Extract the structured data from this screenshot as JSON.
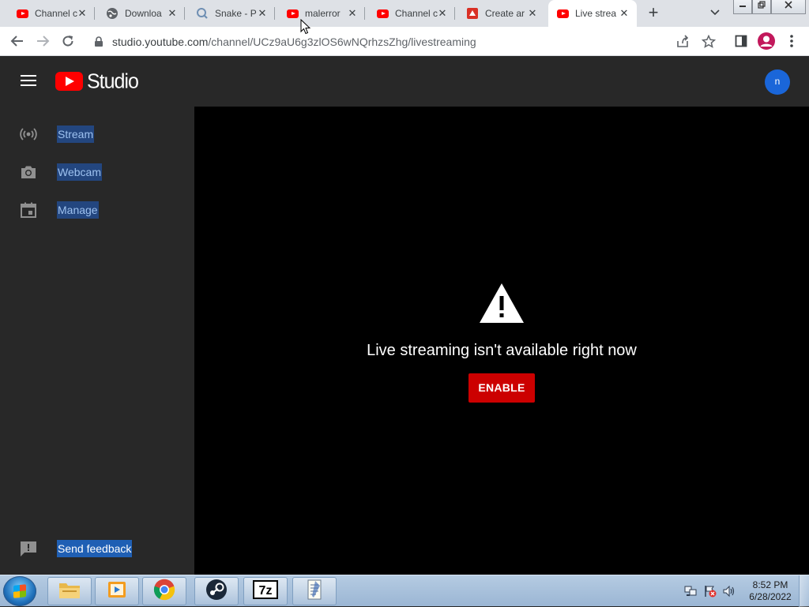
{
  "browser": {
    "tabs": [
      {
        "title": "Channel c",
        "favicon": "youtube-icon",
        "active": false
      },
      {
        "title": "Downloa",
        "favicon": "globe-icon",
        "active": false
      },
      {
        "title": "Snake - P",
        "favicon": "search-icon",
        "active": false
      },
      {
        "title": "malerror",
        "favicon": "youtube-icon",
        "active": false
      },
      {
        "title": "Channel c",
        "favicon": "youtube-icon",
        "active": false
      },
      {
        "title": "Create ar",
        "favicon": "app-icon",
        "active": false
      },
      {
        "title": "Live strea",
        "favicon": "youtube-icon",
        "active": true
      }
    ],
    "new_tab_label": "+",
    "url_host": "studio.youtube.com",
    "url_path": "/channel/UCz9aU6g3zlOS6wNQrhzsZhg/livestreaming"
  },
  "header": {
    "logo_text": "Studio",
    "avatar_letter": "n"
  },
  "sidebar": {
    "items": [
      {
        "label": "Stream",
        "icon": "broadcast-icon"
      },
      {
        "label": "Webcam",
        "icon": "camera-icon"
      },
      {
        "label": "Manage",
        "icon": "calendar-icon"
      }
    ],
    "feedback_label": "Send feedback"
  },
  "main": {
    "message": "Live streaming isn't available right now",
    "enable_label": "ENABLE"
  },
  "taskbar": {
    "time": "8:52 PM",
    "date": "6/28/2022"
  },
  "colors": {
    "brand_red": "#ff0000",
    "enable_button": "#cc0000",
    "sidebar_bg": "#282828",
    "main_bg": "#000000",
    "avatar_blue": "#1a66d9"
  }
}
